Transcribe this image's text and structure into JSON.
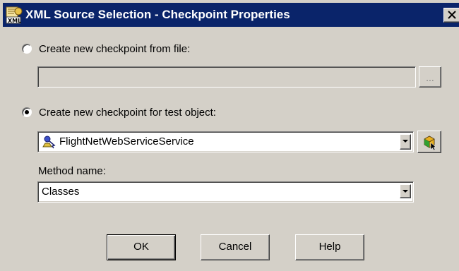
{
  "window": {
    "title": "XML Source Selection - Checkpoint Properties",
    "icon": "xml-icon"
  },
  "from_file": {
    "label": "Create new checkpoint from file:",
    "selected": false,
    "path_value": "",
    "browse_label": "..."
  },
  "from_object": {
    "label": "Create new checkpoint for test object:",
    "selected": true,
    "object_value": "FlightNetWebServiceService",
    "object_icon": "web-service-icon",
    "pick_icon": "object-pointer-icon"
  },
  "method": {
    "label": "Method name:",
    "value": "Classes"
  },
  "buttons": {
    "ok": "OK",
    "cancel": "Cancel",
    "help": "Help"
  },
  "colors": {
    "title_bar": "#0a246a",
    "dialog_face": "#d4d0c8"
  }
}
